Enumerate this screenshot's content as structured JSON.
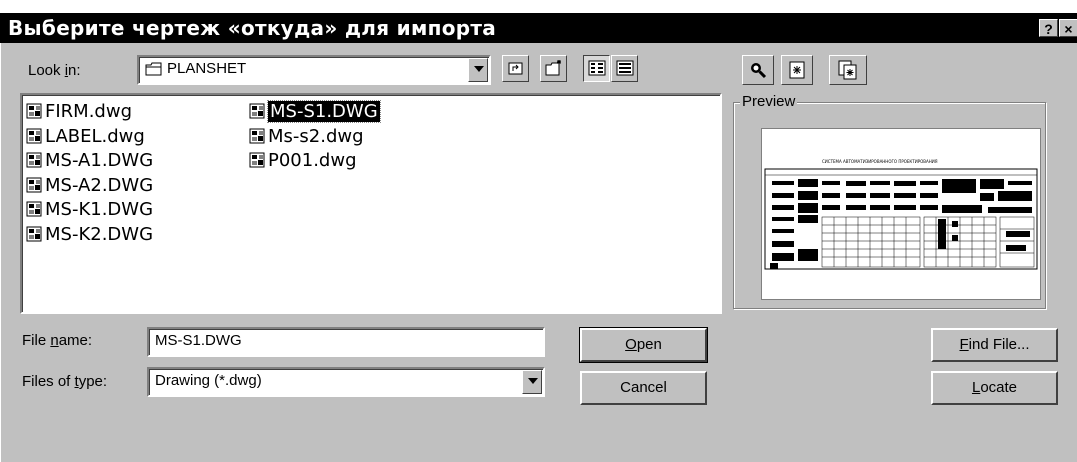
{
  "window": {
    "title": "Выберите чертеж «откуда» для импорта",
    "help_btn": "?",
    "close_btn": "×"
  },
  "look_in": {
    "label_pre": "Look ",
    "label_ul": "i",
    "label_post": "n:",
    "value": "PLANSHET"
  },
  "files": [
    {
      "name": "FIRM.dwg",
      "selected": false
    },
    {
      "name": "LABEL.dwg",
      "selected": false
    },
    {
      "name": "MS-A1.DWG",
      "selected": false
    },
    {
      "name": "MS-A2.DWG",
      "selected": false
    },
    {
      "name": "MS-K1.DWG",
      "selected": false
    },
    {
      "name": "MS-K2.DWG",
      "selected": false
    },
    {
      "name": "MS-S1.DWG",
      "selected": true
    },
    {
      "name": "Ms-s2.dwg",
      "selected": false
    },
    {
      "name": "P001.dwg",
      "selected": false
    }
  ],
  "preview": {
    "label": "Preview",
    "drawing_caption": "СИСТЕМА АВТОМАТИЗИРОВАННОГО ПРОЕКТИРОВАНИЯ"
  },
  "file_name": {
    "label_pre": "File ",
    "label_ul": "n",
    "label_post": "ame:",
    "value": "MS-S1.DWG"
  },
  "files_of_type": {
    "label_pre": "Files of ",
    "label_ul": "t",
    "label_post": "ype:",
    "value": "Drawing (*.dwg)"
  },
  "buttons": {
    "open_ul": "O",
    "open_rest": "pen",
    "cancel": "Cancel",
    "find_ul": "F",
    "find_rest": "ind File...",
    "locate_ul": "L",
    "locate_rest": "ocate"
  },
  "colors": {
    "face": "#c0c0c0",
    "titlebar": "#000000",
    "selection": "#000000"
  }
}
